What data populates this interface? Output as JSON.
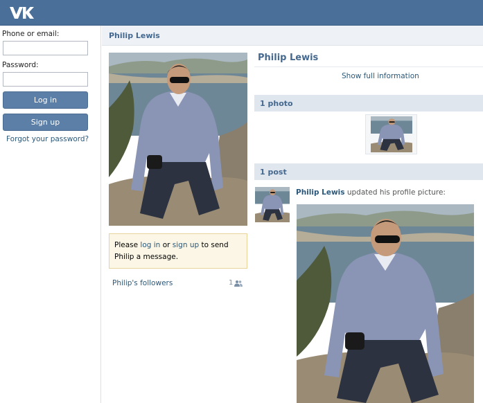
{
  "login": {
    "email_label": "Phone or email:",
    "password_label": "Password:",
    "login_button": "Log in",
    "signup_button": "Sign up",
    "forgot_link": "Forgot your password?"
  },
  "profile": {
    "header_name": "Philip Lewis",
    "name": "Philip Lewis",
    "show_full_info": "Show full information"
  },
  "message_box": {
    "please": "Please",
    "login_link": "log in",
    "or": "or",
    "signup_link": "sign up",
    "rest": "to send Philip a message."
  },
  "followers": {
    "label": "Philip's followers",
    "count": "1"
  },
  "photos_section": {
    "title": "1 photo"
  },
  "posts_section": {
    "title": "1 post"
  },
  "post": {
    "author": "Philip Lewis",
    "action": "updated his profile picture:"
  },
  "colors": {
    "topbar": "#4a6f99",
    "link": "#2b587a",
    "heading": "#45688e",
    "section_bg": "#dfe6ee",
    "message_bg": "#fbf6e6"
  },
  "icons": {
    "logo": "vk-logo-icon",
    "followers": "people-icon"
  }
}
